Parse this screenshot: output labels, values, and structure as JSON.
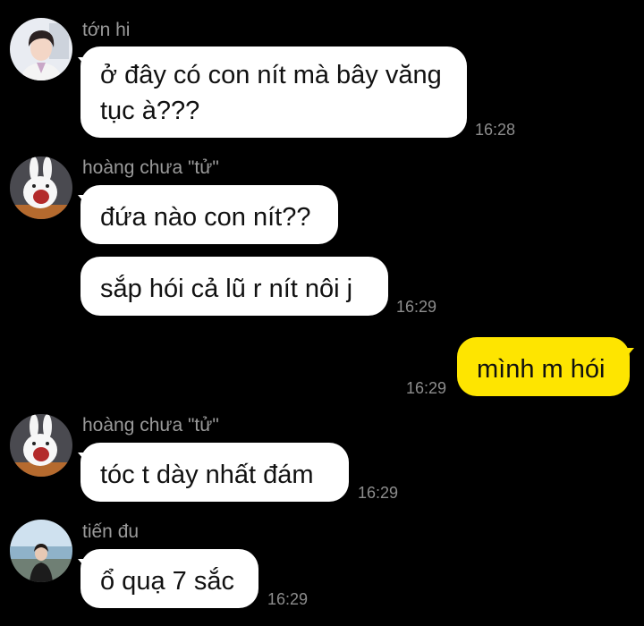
{
  "chat": {
    "messages": [
      {
        "sender": "tớn hi",
        "avatar_icon": "boy-portrait-avatar-icon",
        "text": "ở đây có con nít mà bây văng tục à???",
        "time": "16:28",
        "outgoing": false
      },
      {
        "sender": "hoàng chưa \"tử\"",
        "avatar_icon": "rabbit-avatar-icon",
        "text": "đứa nào con nít??",
        "time": "",
        "outgoing": false
      },
      {
        "sender": "",
        "avatar_icon": "",
        "text": "sắp hói cả lũ r nít nôi j",
        "time": "16:29",
        "outgoing": false
      },
      {
        "sender": "",
        "avatar_icon": "",
        "text": "mình m hói",
        "time": "16:29",
        "outgoing": true
      },
      {
        "sender": "hoàng chưa \"tử\"",
        "avatar_icon": "rabbit-avatar-icon",
        "text": "tóc t dày nhất đám",
        "time": "16:29",
        "outgoing": false
      },
      {
        "sender": "tiến đu",
        "avatar_icon": "seaside-photo-avatar-icon",
        "text": "ổ quạ 7 sắc",
        "time": "16:29",
        "outgoing": false
      }
    ]
  },
  "colors": {
    "background": "#000000",
    "incoming_bubble": "#ffffff",
    "outgoing_bubble": "#fee500",
    "sender_name": "#9a9a9a",
    "timestamp": "#8d8d8d"
  }
}
